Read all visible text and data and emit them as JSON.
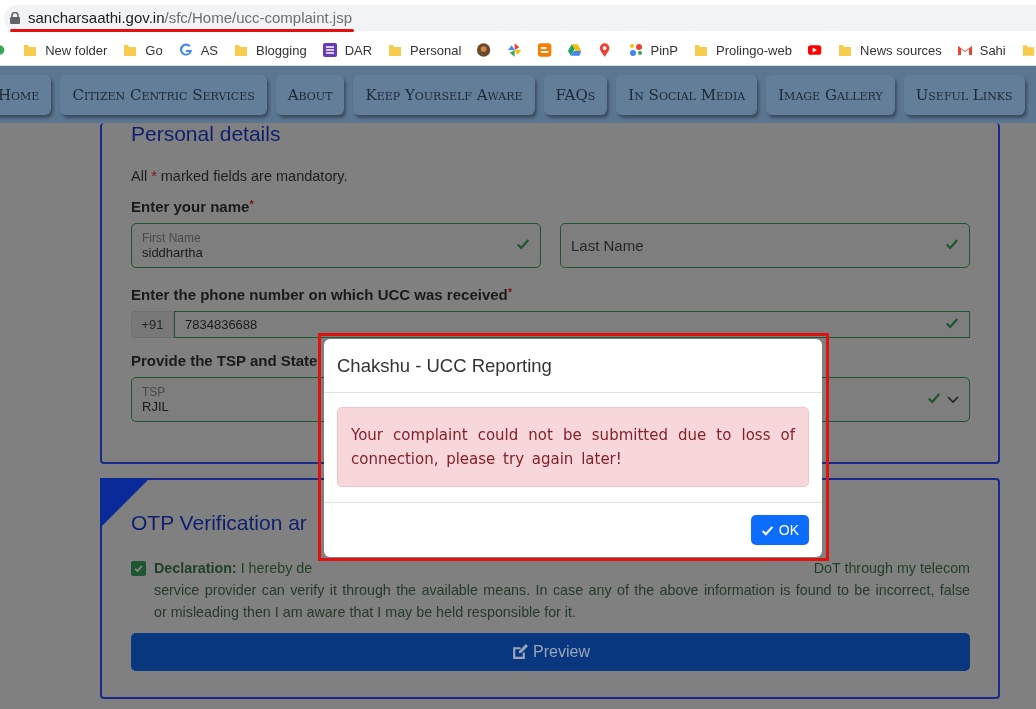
{
  "browser": {
    "url_host": "sancharsaathi.gov.in",
    "url_path": "/sfc/Home/ucc-complaint.jsp"
  },
  "bookmarks": [
    {
      "kind": "apps"
    },
    {
      "kind": "folder",
      "label": "New folder"
    },
    {
      "kind": "folder",
      "label": "Go"
    },
    {
      "kind": "google",
      "label": "AS"
    },
    {
      "kind": "folder",
      "label": "Blogging"
    },
    {
      "kind": "sheet",
      "label": "DAR"
    },
    {
      "kind": "folder",
      "label": "Personal"
    },
    {
      "kind": "avatar"
    },
    {
      "kind": "pinwheel"
    },
    {
      "kind": "blogger"
    },
    {
      "kind": "drive"
    },
    {
      "kind": "pin"
    },
    {
      "kind": "dots",
      "label": "PinP"
    },
    {
      "kind": "folder",
      "label": "Prolingo-web"
    },
    {
      "kind": "video"
    },
    {
      "kind": "folder",
      "label": "News sources"
    },
    {
      "kind": "mail",
      "label": "Sahi"
    },
    {
      "kind": "folder"
    }
  ],
  "nav": [
    {
      "label": "Home"
    },
    {
      "label": "Citizen Centric Services"
    },
    {
      "label": "About"
    },
    {
      "label": "Keep Yourself Aware"
    },
    {
      "label": "FAQs"
    },
    {
      "label": "In Social Media"
    },
    {
      "label": "Image Gallery"
    },
    {
      "label": "Useful Links"
    }
  ],
  "personal": {
    "title": "Personal details",
    "note": {
      "before": "All",
      "mark": "*",
      "after": "marked fields are mandatory."
    },
    "name_label": {
      "text": "Enter your name",
      "mark": "*"
    },
    "first_name": {
      "label": "First Name",
      "value": "siddhartha",
      "valid": true
    },
    "last_name": {
      "placeholder": "Last Name",
      "valid": true
    },
    "phone_label": {
      "text": "Enter the phone number on which UCC was received",
      "mark": "*"
    },
    "phone": {
      "prefix": "+91",
      "value": "7834836688",
      "valid": true
    },
    "tsp_label": {
      "text": "Provide the TSP and State"
    },
    "tsp": {
      "label": "TSP",
      "value": "RJIL"
    },
    "state": {
      "valid": true
    }
  },
  "otp": {
    "title": "OTP Verification ar",
    "declaration": {
      "checked": true,
      "lead": "Declaration:",
      "line_1a": "I hereby de",
      "line_1b": "DoT through my telecom",
      "line_2": "service provider can verify it through the available means. In case any of the above information is found to be incorrect, false",
      "line_3": "or misleading then I am aware that I may be held responsible for it."
    },
    "preview_button": "Preview"
  },
  "modal": {
    "title": "Chakshu - UCC Reporting",
    "message": "Your complaint could not be submitted due to loss of connection, please try again later!",
    "ok_button": "OK"
  },
  "annotations": {
    "url_underline": true,
    "modal_box": true
  }
}
